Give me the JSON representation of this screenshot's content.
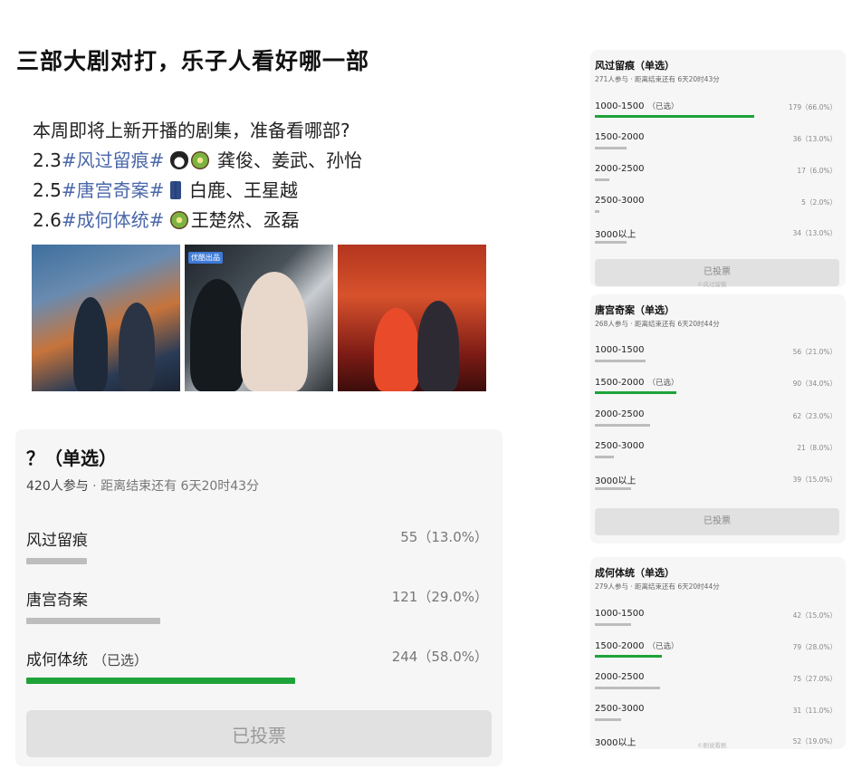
{
  "title": "三部大剧对打，乐子人看好哪一部",
  "description": {
    "line1": "本周即将上新开播的剧集，准备看哪部?",
    "items": [
      {
        "date": "2.3",
        "tag": "#风过留痕#",
        "cast": "龚俊、姜武、孙怡",
        "icons": [
          "penguin-icon",
          "kiwi-icon"
        ]
      },
      {
        "date": "2.5",
        "tag": "#唐宫奇案#",
        "cast": "白鹿、王星越",
        "icons": [
          "jeans-icon"
        ]
      },
      {
        "date": "2.6",
        "tag": "#成何体统#",
        "cast": "王楚然、丞磊",
        "icons": [
          "kiwi-icon"
        ]
      }
    ]
  },
  "posters": [
    {
      "name": "poster-fengguo-liuhen"
    },
    {
      "name": "poster-tanggong-qian",
      "badge": "优酷出品"
    },
    {
      "name": "poster-chenghe-titong"
    }
  ],
  "main_poll": {
    "question": "？（单选）",
    "participants": "420人参与",
    "deadline": " · 距离结束还有 6天20时43分",
    "options": [
      {
        "label": "风过留痕",
        "selected": "",
        "count": "55（13.0%）",
        "fraction": 0.13
      },
      {
        "label": "唐宫奇案",
        "selected": "",
        "count": "121（29.0%）",
        "fraction": 0.29
      },
      {
        "label": "成何体统",
        "selected": "（已选）",
        "count": "244（58.0%）",
        "fraction": 0.58
      }
    ],
    "voted_label": "已投票"
  },
  "side_polls": [
    {
      "title": "风过留痕（单选）",
      "meta": "271人参与 · 距离结束还有 6天20时43分",
      "options": [
        {
          "label": "1000-1500",
          "selected": "（已选）",
          "count": "179（66.0%）",
          "fraction": 0.66
        },
        {
          "label": "1500-2000",
          "selected": "",
          "count": "36（13.0%）",
          "fraction": 0.13
        },
        {
          "label": "2000-2500",
          "selected": "",
          "count": "17（6.0%）",
          "fraction": 0.06
        },
        {
          "label": "2500-3000",
          "selected": "",
          "count": "5（2.0%）",
          "fraction": 0.02
        },
        {
          "label": "3000以上",
          "selected": "",
          "count": "34（13.0%）",
          "fraction": 0.13
        }
      ],
      "voted_label": "已投票",
      "watermark": "©风过留痕"
    },
    {
      "title": "唐宫奇案（单选）",
      "meta": "268人参与 · 距离结束还有 6天20时44分",
      "options": [
        {
          "label": "1000-1500",
          "selected": "",
          "count": "56（21.0%）",
          "fraction": 0.21
        },
        {
          "label": "1500-2000",
          "selected": "（已选）",
          "count": "90（34.0%）",
          "fraction": 0.34
        },
        {
          "label": "2000-2500",
          "selected": "",
          "count": "62（23.0%）",
          "fraction": 0.23
        },
        {
          "label": "2500-3000",
          "selected": "",
          "count": "21（8.0%）",
          "fraction": 0.08
        },
        {
          "label": "3000以上",
          "selected": "",
          "count": "39（15.0%）",
          "fraction": 0.15
        }
      ],
      "voted_label": "已投票"
    },
    {
      "title": "成何体统（单选）",
      "meta": "279人参与 · 距离结束还有 6天20时44分",
      "options": [
        {
          "label": "1000-1500",
          "selected": "",
          "count": "42（15.0%）",
          "fraction": 0.15
        },
        {
          "label": "1500-2000",
          "selected": "（已选）",
          "count": "79（28.0%）",
          "fraction": 0.28
        },
        {
          "label": "2000-2500",
          "selected": "",
          "count": "75（27.0%）",
          "fraction": 0.27
        },
        {
          "label": "2500-3000",
          "selected": "",
          "count": "31（11.0%）",
          "fraction": 0.11
        },
        {
          "label": "3000以上",
          "selected": "",
          "count": "52（19.0%）",
          "fraction": 0.19
        }
      ],
      "watermark": "©剧说看剧"
    }
  ],
  "colors": {
    "accent_green": "#1ea33a",
    "bar_gray": "#bdbdbd",
    "tag_blue": "#4a67a8"
  }
}
